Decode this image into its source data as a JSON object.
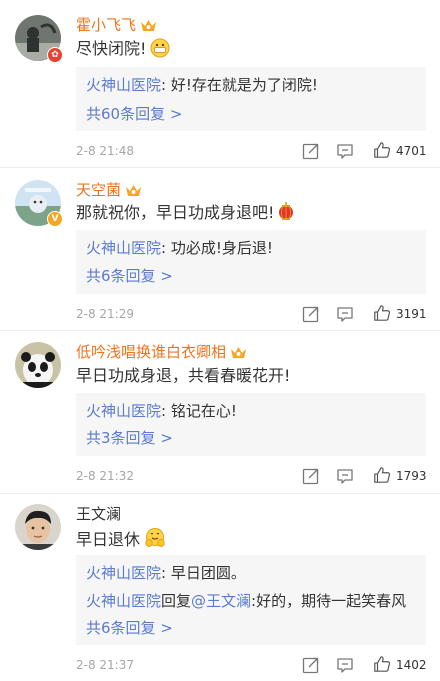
{
  "comments": [
    {
      "user": "霍小飞飞",
      "text": "尽快闭院!",
      "reply_author": "火神山医院",
      "reply_text": ": 好!存在就是为了闭院!",
      "reply_author2": "",
      "reply_mid": "",
      "reply_mention": "",
      "reply_text2": "",
      "more": "共60条回复 >",
      "time": "2-8 21:48",
      "likes": "4701"
    },
    {
      "user": "天空菌",
      "text": "那就祝你，早日功成身退吧!",
      "reply_author": "火神山医院",
      "reply_text": ": 功必成!身后退!",
      "reply_author2": "",
      "reply_mid": "",
      "reply_mention": "",
      "reply_text2": "",
      "more": "共6条回复 >",
      "time": "2-8 21:29",
      "likes": "3191"
    },
    {
      "user": "低吟浅唱换谁白衣卿相",
      "text": "早日功成身退，共看春暖花开!",
      "reply_author": "火神山医院",
      "reply_text": ": 铭记在心!",
      "reply_author2": "",
      "reply_mid": "",
      "reply_mention": "",
      "reply_text2": "",
      "more": "共3条回复 >",
      "time": "2-8 21:32",
      "likes": "1793"
    },
    {
      "user": "王文澜",
      "text": "早日退休",
      "reply_author": "火神山医院",
      "reply_text": ": 早日团圆。",
      "reply_author2": "火神山医院",
      "reply_mid": "回复",
      "reply_mention": "@王文澜",
      "reply_text2": ":好的，期待一起笑春风",
      "more": "共6条回复 >",
      "time": "2-8 21:37",
      "likes": "1402"
    }
  ],
  "icons": {
    "share": "share-icon",
    "comment": "comment-icon",
    "like": "like-icon",
    "crown": "vip-crown-icon"
  },
  "colors": {
    "link": "#5b7bd1",
    "vip_name": "#f0731c",
    "reply_bg": "#f6f6f6",
    "meta": "#a6a6a6"
  }
}
